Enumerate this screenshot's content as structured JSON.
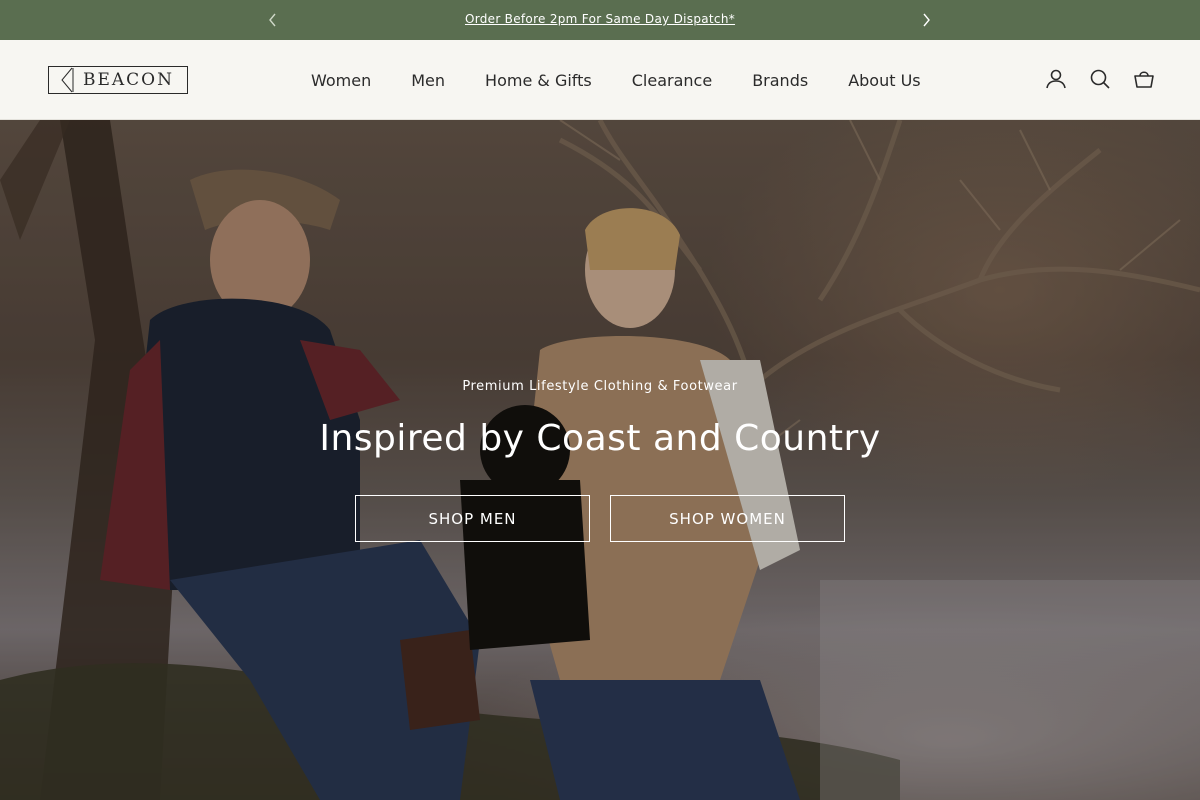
{
  "announcement": {
    "text": "Order Before 2pm For Same Day Dispatch*",
    "prev_icon": "chevron-left-icon",
    "next_icon": "chevron-right-icon"
  },
  "header": {
    "logo_text": "BEACON",
    "nav": [
      "Women",
      "Men",
      "Home & Gifts",
      "Clearance",
      "Brands",
      "About Us"
    ],
    "icons": [
      "account-icon",
      "search-icon",
      "basket-icon"
    ]
  },
  "hero": {
    "subtitle": "Premium Lifestyle Clothing & Footwear",
    "title": "Inspired by Coast and Country",
    "buttons": {
      "men": "SHOP MEN",
      "women": "SHOP WOMEN"
    }
  },
  "colors": {
    "announcement_bg": "#5a6e50",
    "header_bg": "#f7f6f2",
    "text_dark": "#2b2b2b"
  }
}
